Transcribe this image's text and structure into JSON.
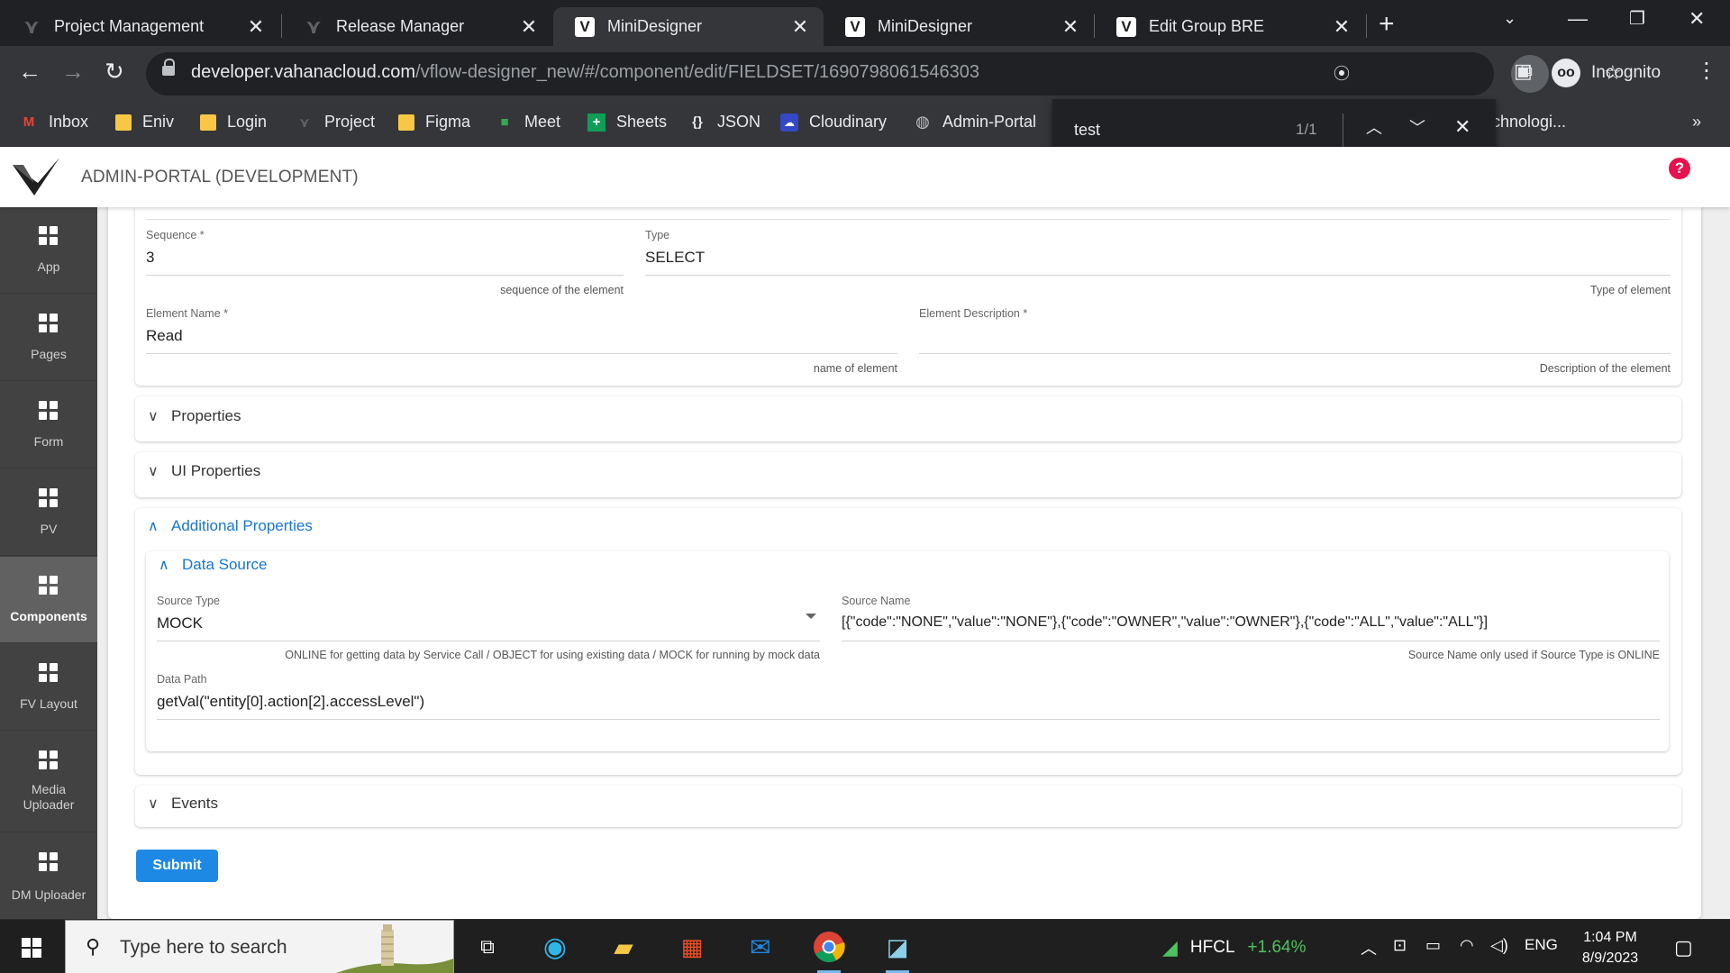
{
  "browser": {
    "tabs": [
      {
        "title": "Project Management",
        "icon": "vahana-logo-icon",
        "active": false
      },
      {
        "title": "Release Manager",
        "icon": "vahana-logo-icon",
        "active": false
      },
      {
        "title": "MiniDesigner",
        "icon": "v-logo-icon",
        "active": true
      },
      {
        "title": "MiniDesigner",
        "icon": "v-logo-icon",
        "active": false
      },
      {
        "title": "Edit Group BRE",
        "icon": "v-logo-icon",
        "active": false
      }
    ],
    "url_host": "developer.vahanacloud.com",
    "url_path": "/vflow-designer_new/#/component/edit/FIELDSET/1690798061546303",
    "profile_label": "Incognito",
    "bookmarks": [
      "Inbox",
      "Eniv",
      "Login",
      "Project",
      "Figma",
      "Meet",
      "Sheets",
      "JSON",
      "Cloudinary",
      "Admin-Portal",
      "chnologi..."
    ],
    "find": {
      "query": "test",
      "count": "1/1"
    }
  },
  "app": {
    "title": "ADMIN-PORTAL (DEVELOPMENT)",
    "help_symbol": "?",
    "sidebar": [
      {
        "label": "App",
        "active": false
      },
      {
        "label": "Pages",
        "active": false
      },
      {
        "label": "Form",
        "active": false
      },
      {
        "label": "PV",
        "active": false
      },
      {
        "label": "Components",
        "active": true
      },
      {
        "label": "FV Layout",
        "active": false
      },
      {
        "label": "Media Uploader",
        "active": false
      },
      {
        "label": "DM Uploader",
        "active": false
      }
    ],
    "form": {
      "sequence": {
        "label": "Sequence *",
        "value": "3",
        "hint": "sequence of the element"
      },
      "type": {
        "label": "Type",
        "value": "SELECT",
        "hint": "Type of element"
      },
      "element_name": {
        "label": "Element Name *",
        "value": "Read",
        "hint": "name of element"
      },
      "element_description": {
        "label": "Element Description *",
        "value": "",
        "hint": "Description of the element"
      },
      "sections": {
        "properties": "Properties",
        "ui_properties": "UI Properties",
        "additional_properties": "Additional Properties",
        "data_source": "Data Source",
        "events": "Events"
      },
      "source_type": {
        "label": "Source Type",
        "value": "MOCK",
        "hint": "ONLINE for getting data by Service Call / OBJECT for using existing data / MOCK for running by mock data"
      },
      "source_name": {
        "label": "Source Name",
        "value": "[{\"code\":\"NONE\",\"value\":\"NONE\"},{\"code\":\"OWNER\",\"value\":\"OWNER\"},{\"code\":\"ALL\",\"value\":\"ALL\"}]",
        "hint": "Source Name only used if Source Type is ONLINE"
      },
      "data_path": {
        "label": "Data Path",
        "value": "getVal(\"entity[0].action[2].accessLevel\")"
      },
      "submit_label": "Submit"
    }
  },
  "taskbar": {
    "search_placeholder": "Type here to search",
    "stock_symbol": "HFCL",
    "stock_change": "+1.64%",
    "language": "ENG",
    "time": "1:04 PM",
    "date": "8/9/2023"
  },
  "colors": {
    "accent_blue": "#1976d2",
    "submit_blue": "#1e88e5",
    "sidebar_bg": "#424242",
    "help_red": "#e8114d",
    "stock_green": "#4ec25e"
  }
}
